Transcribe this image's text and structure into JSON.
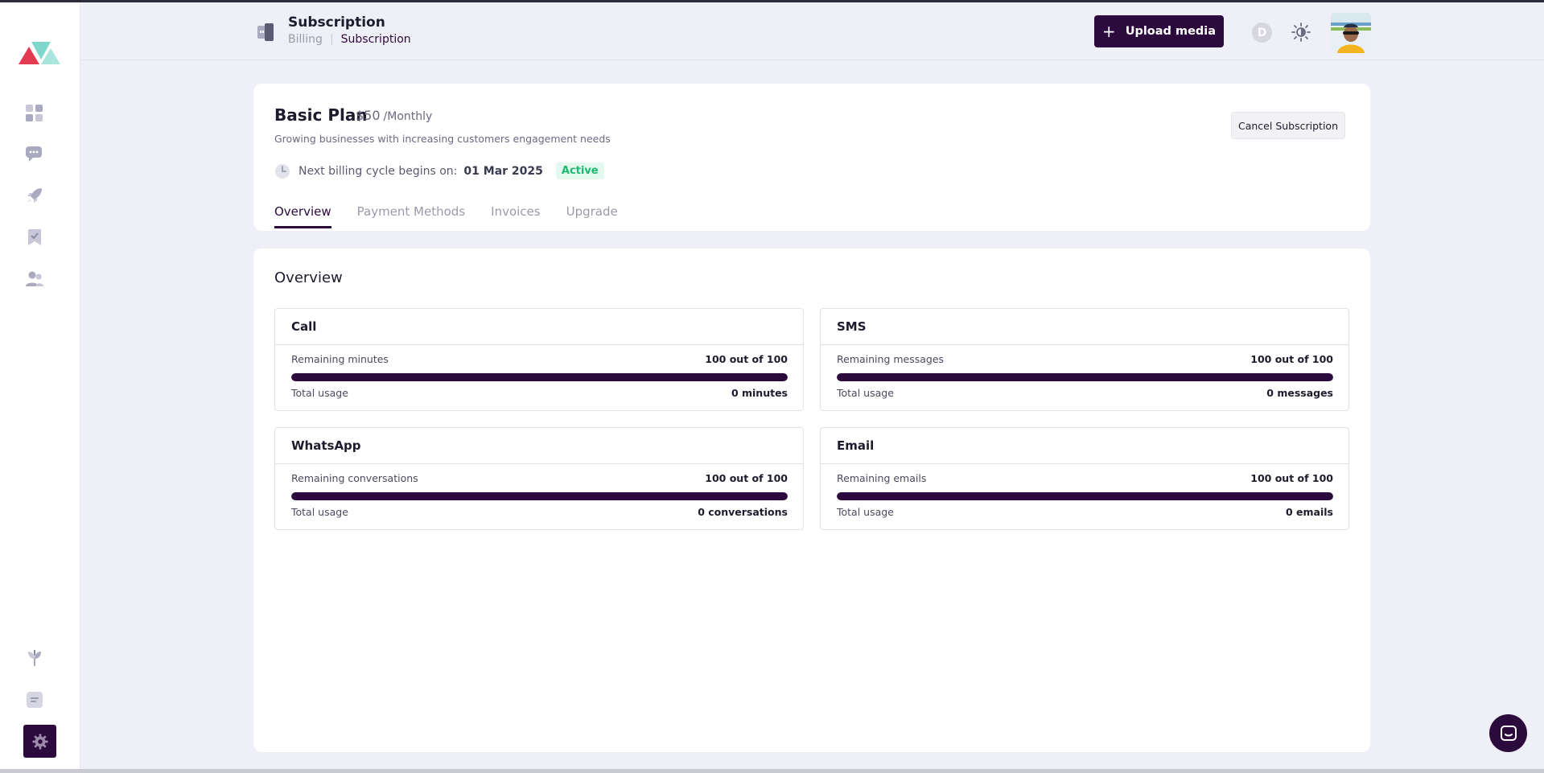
{
  "header": {
    "title": "Subscription",
    "breadcrumb": [
      "Billing",
      "Subscription"
    ],
    "upload_label": "Upload media",
    "avatar_initial": "D"
  },
  "sidebar": {
    "items": [
      {
        "icon": "dashboard-icon"
      },
      {
        "icon": "chat-icon"
      },
      {
        "icon": "rocket-icon"
      },
      {
        "icon": "bookmark-icon"
      },
      {
        "icon": "contacts-icon"
      }
    ],
    "bottom": [
      {
        "icon": "plant-icon"
      },
      {
        "icon": "notes-icon"
      },
      {
        "icon": "settings-icon",
        "active": true
      }
    ]
  },
  "plan": {
    "name": "Basic Plan",
    "price": "$50",
    "period": "/Monthly",
    "description": "Growing businesses with increasing customers engagement needs",
    "billing_label": "Next billing cycle begins on:",
    "billing_date": "01 Mar 2025",
    "status": "Active",
    "cancel_label": "Cancel Subscription"
  },
  "tabs": [
    "Overview",
    "Payment Methods",
    "Invoices",
    "Upgrade"
  ],
  "active_tab": "Overview",
  "overview": {
    "title": "Overview",
    "cards": [
      {
        "title": "Call",
        "remaining_label": "Remaining minutes",
        "remaining_value": "100 out of 100",
        "usage_label": "Total usage",
        "usage_value": "0 minutes",
        "remaining_fraction": 1.0
      },
      {
        "title": "SMS",
        "remaining_label": "Remaining messages",
        "remaining_value": "100 out of 100",
        "usage_label": "Total usage",
        "usage_value": "0 messages",
        "remaining_fraction": 1.0
      },
      {
        "title": "WhatsApp",
        "remaining_label": "Remaining conversations",
        "remaining_value": "100 out of 100",
        "usage_label": "Total usage",
        "usage_value": "0 conversations",
        "remaining_fraction": 1.0
      },
      {
        "title": "Email",
        "remaining_label": "Remaining emails",
        "remaining_value": "100 out of 100",
        "usage_label": "Total usage",
        "usage_value": "0 emails",
        "remaining_fraction": 1.0
      }
    ]
  },
  "colors": {
    "brand": "#2d0a3d",
    "active_green": "#1fb86f",
    "logo_red": "#e23a4e",
    "logo_teal": "#6fcfc4"
  }
}
